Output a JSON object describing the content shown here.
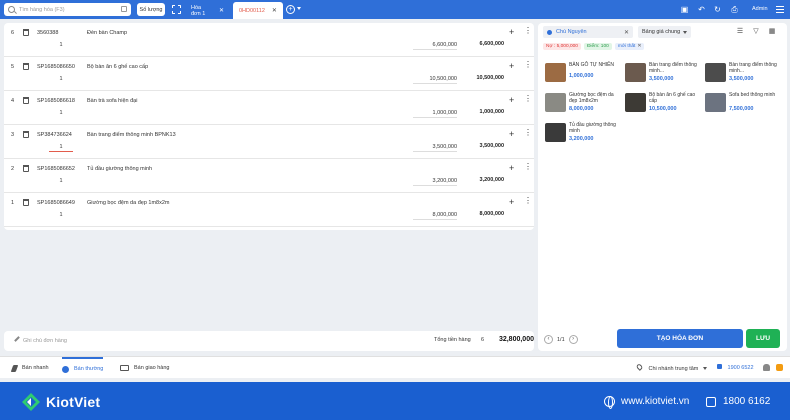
{
  "topbar": {
    "search_placeholder": "Tìm hàng hóa (F3)",
    "serial_label": "Số lượng",
    "tabs": [
      {
        "label": "Hóa đơn 1"
      },
      {
        "label": "0HD00112"
      }
    ],
    "user": "Admin"
  },
  "cart": {
    "items": [
      {
        "index": "6",
        "code": "3560388",
        "name": "Đèn bàn Champ",
        "qty": "1",
        "price": "6,600,000",
        "total": "6,600,000"
      },
      {
        "index": "5",
        "code": "SP1685086650",
        "name": "Bộ bàn ăn 6 ghế cao cấp",
        "qty": "1",
        "price": "10,500,000",
        "total": "10,500,000"
      },
      {
        "index": "4",
        "code": "SP1685086618",
        "name": "Bàn trà sofa hiện đại",
        "qty": "1",
        "price": "1,000,000",
        "total": "1,000,000"
      },
      {
        "index": "3",
        "code": "SP384736624",
        "name": "Bàn trang điểm thông minh BPNK13",
        "qty": "1",
        "price": "3,500,000",
        "total": "3,500,000"
      },
      {
        "index": "2",
        "code": "SP1685086652",
        "name": "Tủ đầu giường thông minh",
        "qty": "1",
        "price": "3,200,000",
        "total": "3,200,000"
      },
      {
        "index": "1",
        "code": "SP1685086649",
        "name": "Giường bọc đệm da đẹp 1m8x2m",
        "qty": "1",
        "price": "8,000,000",
        "total": "8,000,000"
      }
    ],
    "note_placeholder": "Ghi chú đơn hàng",
    "total_label": "Tổng tiền hàng",
    "total_count": "6",
    "total_amount": "32,800,000"
  },
  "customer": {
    "name": "Chú Nguyên",
    "pricelist": "Bảng giá chung",
    "tags": {
      "debt": "Nợ : 5,000,000",
      "points": "Điểm: 100",
      "status": "mới thất"
    }
  },
  "products": [
    {
      "name": "BÀN GỖ TỰ NHIÊN",
      "price": "1,000,000",
      "color": "#9c6b43"
    },
    {
      "name": "Bàn trang điểm thông minh...",
      "price": "3,500,000",
      "color": "#6b5a4e"
    },
    {
      "name": "Bàn trang điểm thông minh...",
      "price": "3,500,000",
      "color": "#4c4c4c"
    },
    {
      "name": "Giường bọc đệm da đẹp 1m8x2m",
      "price": "8,000,000",
      "color": "#8a8a84"
    },
    {
      "name": "Bộ bàn ăn 6 ghế cao cấp",
      "price": "10,500,000",
      "color": "#3d3a35"
    },
    {
      "name": "Sofa bed thông minh",
      "price": "7,500,000",
      "color": "#6c7380"
    },
    {
      "name": "Tủ đầu giường thông minh",
      "price": "3,200,000",
      "color": "#3a3a3a"
    }
  ],
  "pager": {
    "text": "1/1"
  },
  "actions": {
    "create": "TẠO HÓA ĐƠN",
    "save": "LƯU"
  },
  "modes": [
    {
      "label": "Bán nhanh"
    },
    {
      "label": "Bán thường"
    },
    {
      "label": "Bán giao hàng"
    }
  ],
  "branch": "Chi nhánh trung tâm",
  "hotline": "1900 6522",
  "brand": {
    "name": "KiotViet",
    "website": "www.kiotviet.vn",
    "phone": "1800 6162",
    "primary_color": "#2f6fd8",
    "accent_green": "#1fb155"
  }
}
